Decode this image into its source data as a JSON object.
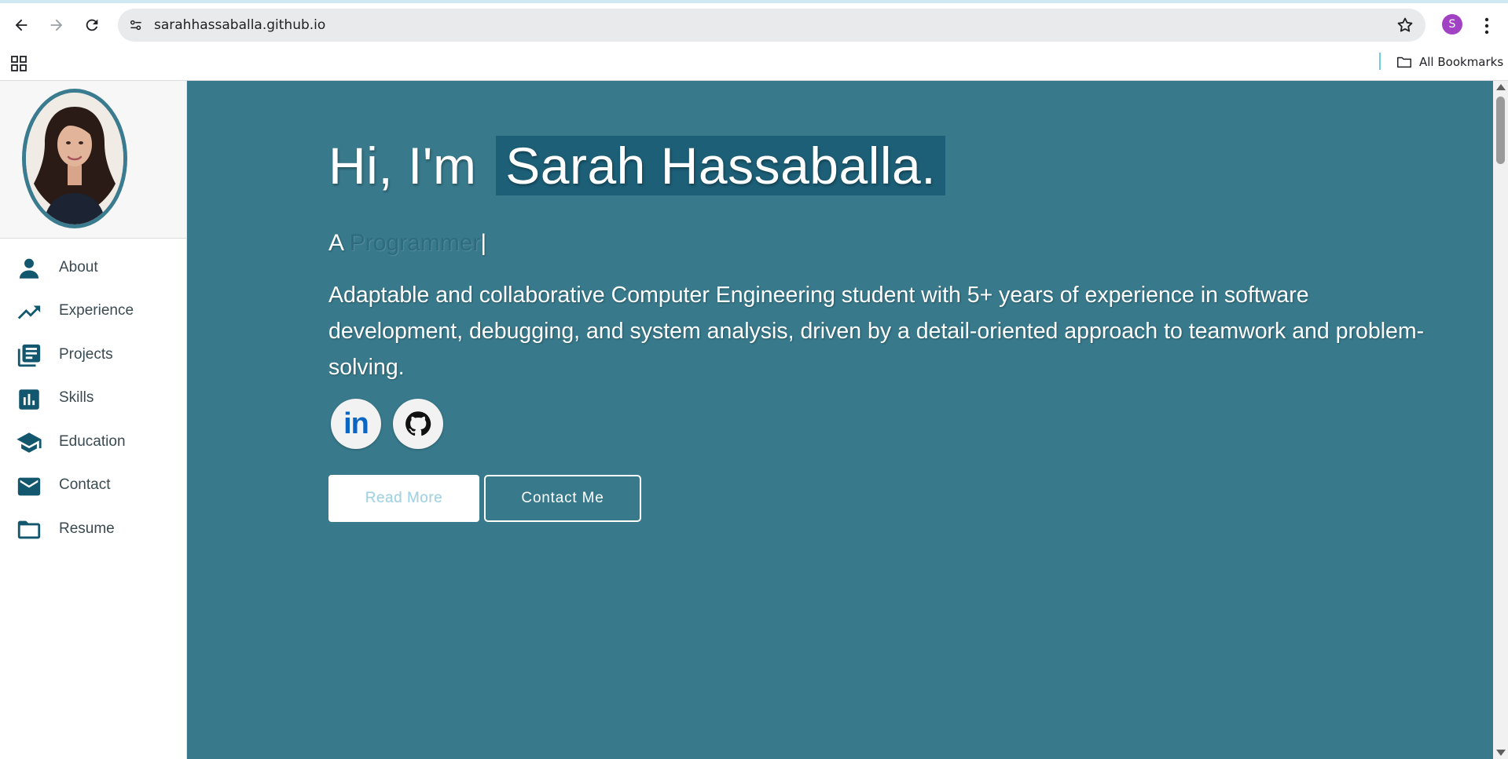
{
  "browser": {
    "url": "sarahhassaballa.github.io",
    "profile_initial": "S",
    "bookmarks_label": "All Bookmarks"
  },
  "sidebar": {
    "items": [
      {
        "label": "About",
        "icon": "person-icon"
      },
      {
        "label": "Experience",
        "icon": "trending-up-icon"
      },
      {
        "label": "Projects",
        "icon": "library-books-icon"
      },
      {
        "label": "Skills",
        "icon": "bar-chart-icon"
      },
      {
        "label": "Education",
        "icon": "graduation-cap-icon"
      },
      {
        "label": "Contact",
        "icon": "mail-icon"
      },
      {
        "label": "Resume",
        "icon": "folder-icon"
      }
    ]
  },
  "hero": {
    "greeting": "Hi, I'm",
    "name": "Sarah Hassaballa.",
    "subtitle_prefix": "A",
    "role": "Programmer",
    "cursor": "|",
    "summary": "Adaptable and collaborative Computer Engineering student with 5+ years of experience in software development, debugging, and system analysis, driven by a detail-oriented approach to teamwork and problem-solving.",
    "linkedin_text": "in",
    "read_more_label": "Read More",
    "contact_label": "Contact Me"
  },
  "colors": {
    "main_bg": "#387a8c",
    "name_highlight": "#1c5f77",
    "icon_color": "#13576e",
    "avatar_border": "#3a7b8f"
  }
}
